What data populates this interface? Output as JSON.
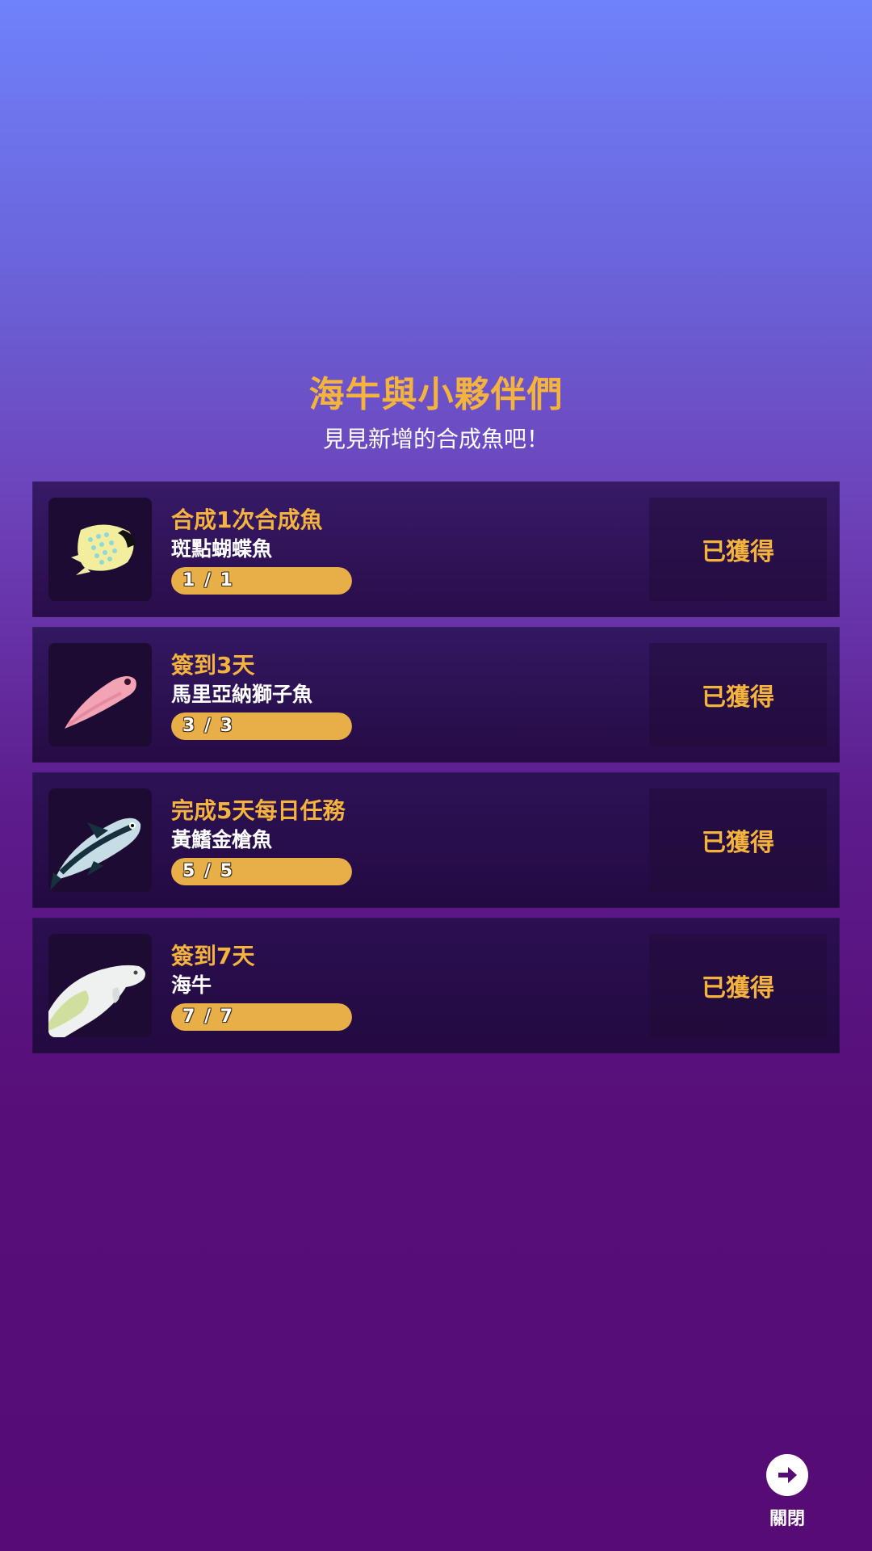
{
  "header": {
    "title": "海牛與小夥伴們",
    "subtitle": "見見新增的合成魚吧！"
  },
  "items": [
    {
      "task": "合成1次合成魚",
      "fish": "斑點蝴蝶魚",
      "progress_text": "1 / 1",
      "progress": 1.0,
      "status": "已獲得",
      "icon": "spotted-butterflyfish-icon"
    },
    {
      "task": "簽到3天",
      "fish": "馬里亞納獅子魚",
      "progress_text": "3 / 3",
      "progress": 1.0,
      "status": "已獲得",
      "icon": "mariana-snailfish-icon"
    },
    {
      "task": "完成5天每日任務",
      "fish": "黃鰭金槍魚",
      "progress_text": "5 / 5",
      "progress": 1.0,
      "status": "已獲得",
      "icon": "yellowfin-tuna-icon"
    },
    {
      "task": "簽到7天",
      "fish": "海牛",
      "progress_text": "7 / 7",
      "progress": 1.0,
      "status": "已獲得",
      "icon": "manatee-icon"
    }
  ],
  "close": {
    "label": "關閉",
    "icon": "arrow-right-icon"
  },
  "colors": {
    "accent": "#f3b33d",
    "progress_fill": "#e8ae47",
    "background_top": "#6f82fb",
    "background_bottom": "#560c74"
  }
}
